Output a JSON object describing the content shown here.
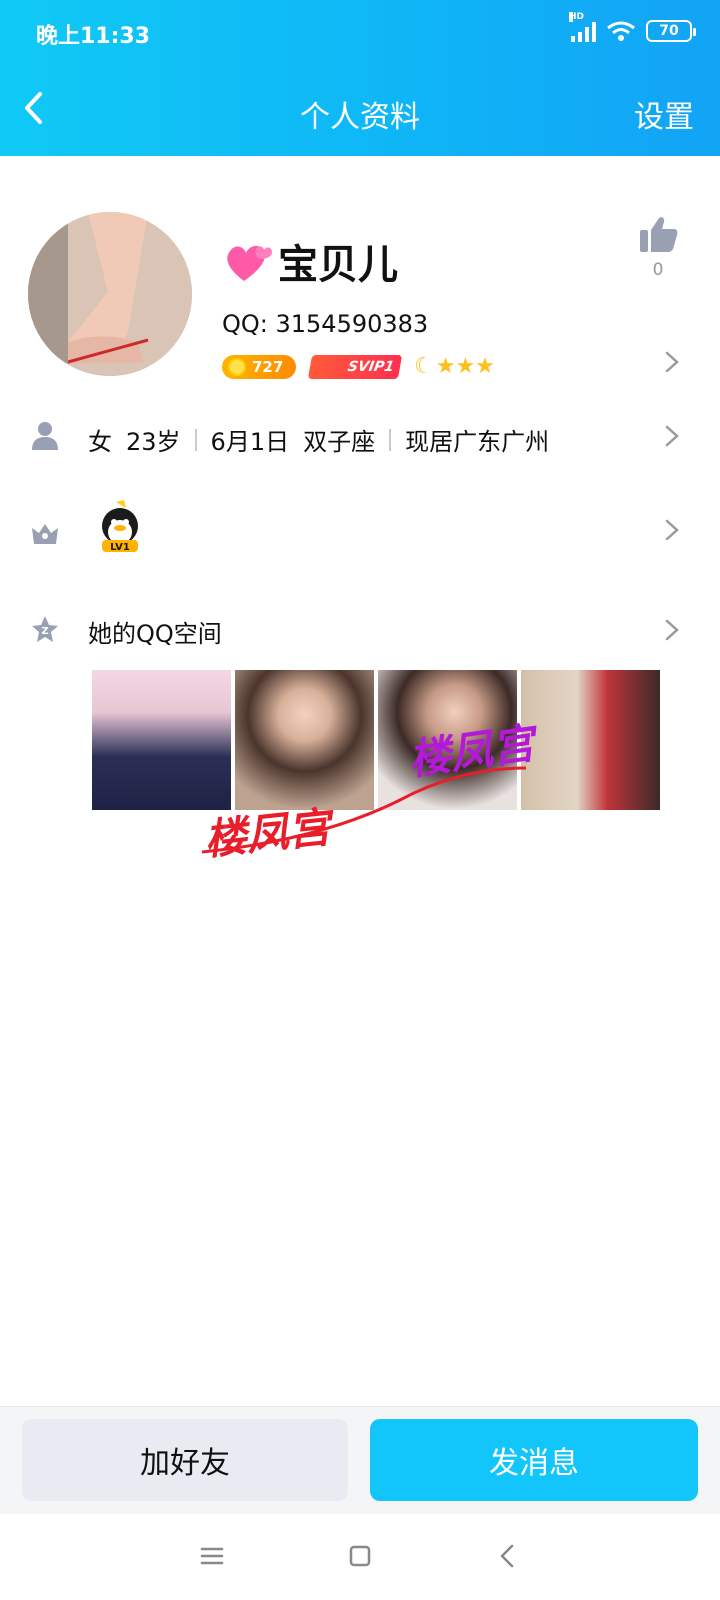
{
  "status_bar": {
    "time": "晚上11:33",
    "network": "HD",
    "battery": "70"
  },
  "header": {
    "title": "个人资料",
    "settings_label": "设置"
  },
  "profile": {
    "nickname": "宝贝儿",
    "qq_label": "QQ: 3154590383",
    "level_badge": "727",
    "vip_badge": "SVIP1",
    "stars": "★★★",
    "like_count": "0"
  },
  "info": {
    "gender": "女",
    "age": "23岁",
    "birthday": "6月1日",
    "zodiac": "双子座",
    "location": "现居广东广州"
  },
  "pet_badge": "LV1",
  "qzone": {
    "title": "她的QQ空间",
    "watermark_a": "楼凤宫",
    "watermark_b": "楼凤宫"
  },
  "actions": {
    "add_friend": "加好友",
    "send_message": "发消息"
  },
  "colors": {
    "header_gradient_start": "#10c9f5",
    "header_gradient_end": "#12a3f5",
    "primary_button": "#12c5fb",
    "secondary_button": "#e9ebf3"
  }
}
